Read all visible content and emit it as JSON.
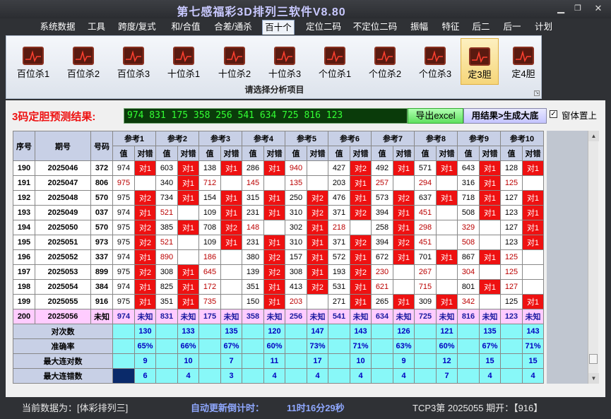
{
  "window": {
    "title": "第七感福彩3D排列三软件V8.80"
  },
  "menu": [
    {
      "label": "系统数据"
    },
    {
      "label": "工具"
    },
    {
      "label": "跨度/复式"
    },
    {
      "label": "和/合值"
    },
    {
      "label": "合差/通杀"
    },
    {
      "label": "百十个"
    },
    {
      "label": "定位二码"
    },
    {
      "label": "不定位二码"
    },
    {
      "label": "振幅"
    },
    {
      "label": "特征"
    },
    {
      "label": "后二"
    },
    {
      "label": "后一"
    },
    {
      "label": "计划"
    }
  ],
  "ribbon": {
    "buttons": [
      {
        "label": "百位杀1"
      },
      {
        "label": "百位杀2"
      },
      {
        "label": "百位杀3"
      },
      {
        "label": "十位杀1"
      },
      {
        "label": "十位杀2"
      },
      {
        "label": "十位杀3"
      },
      {
        "label": "个位杀1"
      },
      {
        "label": "个位杀2"
      },
      {
        "label": "个位杀3"
      },
      {
        "label": "定3胆"
      },
      {
        "label": "定4胆"
      }
    ],
    "caption": "请选择分析项目"
  },
  "prediction": {
    "label": "3码定胆预测结果:",
    "result": "974 831 175 358 256 541 634 725 816 123",
    "export_label": "导出excel",
    "generate_label": "用结果>生成大底",
    "pin_label": "窗体置上",
    "pin_checked": true
  },
  "table": {
    "headers": {
      "seq": "序号",
      "period": "期号",
      "number": "号码",
      "refs": [
        "参考1",
        "参考2",
        "参考3",
        "参考4",
        "参考5",
        "参考6",
        "参考7",
        "参考8",
        "参考9",
        "参考10"
      ],
      "val": "值",
      "result": "对错"
    },
    "rows": [
      {
        "seq": "190",
        "period": "2025046",
        "num": "372",
        "cells": [
          [
            "974",
            "对1"
          ],
          [
            "603",
            "对1"
          ],
          [
            "138",
            "对1"
          ],
          [
            "286",
            "对1"
          ],
          [
            "940",
            ""
          ],
          [
            "427",
            "对2"
          ],
          [
            "492",
            "对1"
          ],
          [
            "571",
            "对1"
          ],
          [
            "643",
            "对1"
          ],
          [
            "128",
            "对1"
          ]
        ]
      },
      {
        "seq": "191",
        "period": "2025047",
        "num": "806",
        "cells": [
          [
            "975",
            ""
          ],
          [
            "340",
            "对1"
          ],
          [
            "712",
            ""
          ],
          [
            "145",
            ""
          ],
          [
            "135",
            ""
          ],
          [
            "203",
            "对1"
          ],
          [
            "257",
            ""
          ],
          [
            "294",
            ""
          ],
          [
            "316",
            "对1"
          ],
          [
            "125",
            ""
          ]
        ]
      },
      {
        "seq": "192",
        "period": "2025048",
        "num": "570",
        "cells": [
          [
            "975",
            "对2"
          ],
          [
            "734",
            "对1"
          ],
          [
            "154",
            "对1"
          ],
          [
            "315",
            "对1"
          ],
          [
            "250",
            "对2"
          ],
          [
            "476",
            "对1"
          ],
          [
            "573",
            "对2"
          ],
          [
            "637",
            "对1"
          ],
          [
            "718",
            "对1"
          ],
          [
            "127",
            "对1"
          ]
        ]
      },
      {
        "seq": "193",
        "period": "2025049",
        "num": "037",
        "cells": [
          [
            "974",
            "对1"
          ],
          [
            "521",
            ""
          ],
          [
            "109",
            "对1"
          ],
          [
            "231",
            "对1"
          ],
          [
            "310",
            "对2"
          ],
          [
            "371",
            "对2"
          ],
          [
            "394",
            "对1"
          ],
          [
            "451",
            ""
          ],
          [
            "508",
            "对1"
          ],
          [
            "123",
            "对1"
          ]
        ]
      },
      {
        "seq": "194",
        "period": "2025050",
        "num": "570",
        "cells": [
          [
            "975",
            "对2"
          ],
          [
            "385",
            "对1"
          ],
          [
            "708",
            "对2"
          ],
          [
            "148",
            ""
          ],
          [
            "302",
            "对1"
          ],
          [
            "218",
            ""
          ],
          [
            "258",
            "对1"
          ],
          [
            "298",
            ""
          ],
          [
            "329",
            ""
          ],
          [
            "127",
            "对1"
          ]
        ]
      },
      {
        "seq": "195",
        "period": "2025051",
        "num": "973",
        "cells": [
          [
            "975",
            "对2"
          ],
          [
            "521",
            ""
          ],
          [
            "109",
            "对1"
          ],
          [
            "231",
            "对1"
          ],
          [
            "310",
            "对1"
          ],
          [
            "371",
            "对2"
          ],
          [
            "394",
            "对2"
          ],
          [
            "451",
            ""
          ],
          [
            "508",
            ""
          ],
          [
            "123",
            "对1"
          ]
        ]
      },
      {
        "seq": "196",
        "period": "2025052",
        "num": "337",
        "cells": [
          [
            "974",
            "对1"
          ],
          [
            "890",
            ""
          ],
          [
            "186",
            ""
          ],
          [
            "380",
            "对2"
          ],
          [
            "157",
            "对1"
          ],
          [
            "572",
            "对1"
          ],
          [
            "672",
            "对1"
          ],
          [
            "701",
            "对1"
          ],
          [
            "867",
            "对1"
          ],
          [
            "125",
            ""
          ]
        ]
      },
      {
        "seq": "197",
        "period": "2025053",
        "num": "899",
        "cells": [
          [
            "975",
            "对2"
          ],
          [
            "308",
            "对1"
          ],
          [
            "645",
            ""
          ],
          [
            "139",
            "对2"
          ],
          [
            "308",
            "对1"
          ],
          [
            "193",
            "对2"
          ],
          [
            "230",
            ""
          ],
          [
            "267",
            ""
          ],
          [
            "304",
            ""
          ],
          [
            "125",
            ""
          ]
        ]
      },
      {
        "seq": "198",
        "period": "2025054",
        "num": "384",
        "cells": [
          [
            "974",
            "对1"
          ],
          [
            "825",
            "对1"
          ],
          [
            "172",
            ""
          ],
          [
            "351",
            "对1"
          ],
          [
            "413",
            "对2"
          ],
          [
            "531",
            "对1"
          ],
          [
            "621",
            ""
          ],
          [
            "715",
            ""
          ],
          [
            "801",
            "对1"
          ],
          [
            "127",
            ""
          ]
        ]
      },
      {
        "seq": "199",
        "period": "2025055",
        "num": "916",
        "cells": [
          [
            "975",
            "对1"
          ],
          [
            "351",
            "对1"
          ],
          [
            "735",
            ""
          ],
          [
            "150",
            "对1"
          ],
          [
            "203",
            ""
          ],
          [
            "271",
            "对1"
          ],
          [
            "265",
            "对1"
          ],
          [
            "309",
            "对1"
          ],
          [
            "342",
            ""
          ],
          [
            "125",
            "对1"
          ]
        ]
      }
    ],
    "forecast": {
      "seq": "200",
      "period": "2025056",
      "num": "未知",
      "cells": [
        [
          "974",
          "未知"
        ],
        [
          "831",
          "未知"
        ],
        [
          "175",
          "未知"
        ],
        [
          "358",
          "未知"
        ],
        [
          "256",
          "未知"
        ],
        [
          "541",
          "未知"
        ],
        [
          "634",
          "未知"
        ],
        [
          "725",
          "未知"
        ],
        [
          "816",
          "未知"
        ],
        [
          "123",
          "未知"
        ]
      ]
    },
    "stats": [
      {
        "label": "对次数",
        "values": [
          "130",
          "133",
          "135",
          "120",
          "147",
          "143",
          "126",
          "121",
          "135",
          "143"
        ]
      },
      {
        "label": "准确率",
        "values": [
          "65%",
          "66%",
          "67%",
          "60%",
          "73%",
          "71%",
          "63%",
          "60%",
          "67%",
          "71%"
        ]
      },
      {
        "label": "最大连对数",
        "values": [
          "9",
          "10",
          "7",
          "11",
          "17",
          "10",
          "9",
          "12",
          "15",
          "15"
        ]
      },
      {
        "label": "最大连错数",
        "values": [
          "6",
          "4",
          "3",
          "4",
          "4",
          "4",
          "4",
          "7",
          "4",
          "4"
        ]
      }
    ]
  },
  "status": {
    "current": "当前数据为：[体彩排列三]",
    "countdown_label": "自动更新倒计时：",
    "countdown": "11时16分29秒",
    "latest": "TCP3第 2025055 期开：【916】"
  },
  "colors": {
    "hit": "#ee1111",
    "forecast_bg": "#ffccff",
    "stats_bg": "#88f8f8",
    "header_bg": "#c8d0e6"
  }
}
